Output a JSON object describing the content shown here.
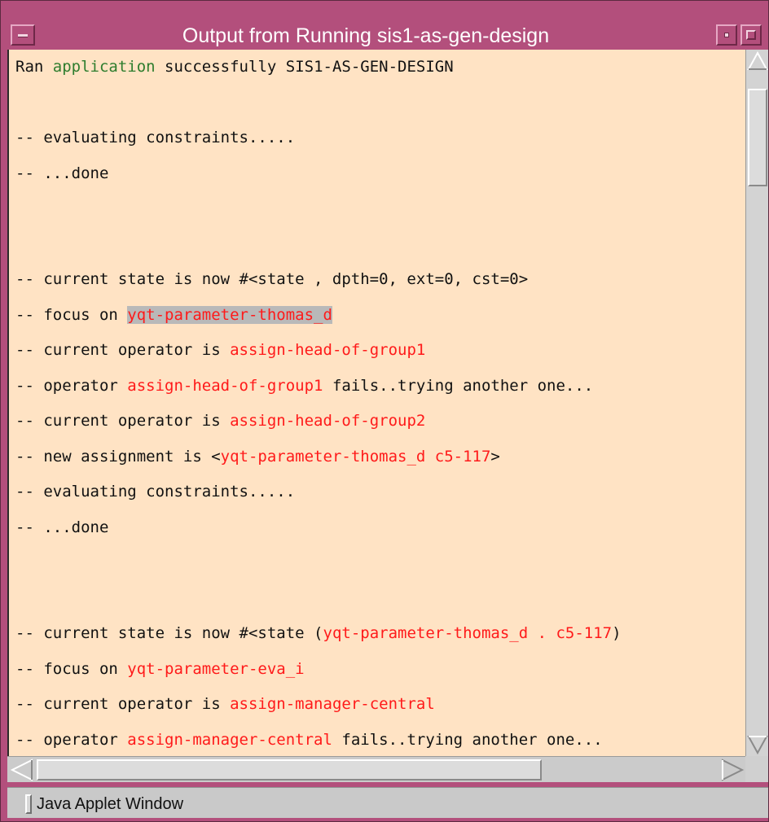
{
  "window": {
    "title": "Output from Running sis1-as-gen-design"
  },
  "output_lines": [
    [
      {
        "t": "Ran ",
        "c": "normal"
      },
      {
        "t": "application",
        "c": "green"
      },
      {
        "t": " successfully SIS1-AS-GEN-DESIGN",
        "c": "normal"
      }
    ],
    [],
    [
      {
        "t": "-- evaluating constraints.....",
        "c": "normal"
      }
    ],
    [
      {
        "t": "-- ...done",
        "c": "normal"
      }
    ],
    [],
    [],
    [
      {
        "t": "-- current state is now #<state , dpth=0, ext=0, cst=0>",
        "c": "normal"
      }
    ],
    [
      {
        "t": "-- focus on ",
        "c": "normal"
      },
      {
        "t": "yqt-parameter-thomas_d",
        "c": "sel"
      }
    ],
    [
      {
        "t": "-- current operator is ",
        "c": "normal"
      },
      {
        "t": "assign-head-of-group1",
        "c": "red"
      }
    ],
    [
      {
        "t": "-- operator ",
        "c": "normal"
      },
      {
        "t": "assign-head-of-group1",
        "c": "red"
      },
      {
        "t": " fails..trying another one...",
        "c": "normal"
      }
    ],
    [
      {
        "t": "-- current operator is ",
        "c": "normal"
      },
      {
        "t": "assign-head-of-group2",
        "c": "red"
      }
    ],
    [
      {
        "t": "-- new assignment is <",
        "c": "normal"
      },
      {
        "t": "yqt-parameter-thomas_d c5-117",
        "c": "red"
      },
      {
        "t": ">",
        "c": "normal"
      }
    ],
    [
      {
        "t": "-- evaluating constraints.....",
        "c": "normal"
      }
    ],
    [
      {
        "t": "-- ...done",
        "c": "normal"
      }
    ],
    [],
    [],
    [
      {
        "t": "-- current state is now #<state (",
        "c": "normal"
      },
      {
        "t": "yqt-parameter-thomas_d . c5-117",
        "c": "red"
      },
      {
        "t": ")",
        "c": "normal"
      }
    ],
    [
      {
        "t": "-- focus on ",
        "c": "normal"
      },
      {
        "t": "yqt-parameter-eva_i",
        "c": "red"
      }
    ],
    [
      {
        "t": "-- current operator is ",
        "c": "normal"
      },
      {
        "t": "assign-manager-central",
        "c": "red"
      }
    ],
    [
      {
        "t": "-- operator ",
        "c": "normal"
      },
      {
        "t": "assign-manager-central",
        "c": "red"
      },
      {
        "t": " fails..trying another one...",
        "c": "normal"
      }
    ]
  ],
  "statusbar": {
    "label": "Java Applet Window"
  },
  "colors": {
    "titlebar": "#b34f7c",
    "text_background": "#ffe3c4",
    "highlight_red": "#ff1a1a",
    "highlight_green": "#2e7d2e",
    "selection": "#b9b9b9"
  },
  "icons": {
    "window_menu": "window-menu-icon",
    "minimize": "minimize-icon",
    "maximize": "maximize-icon",
    "scroll_up": "arrow-up-icon",
    "scroll_down": "arrow-down-icon",
    "scroll_left": "arrow-left-icon",
    "scroll_right": "arrow-right-icon"
  }
}
